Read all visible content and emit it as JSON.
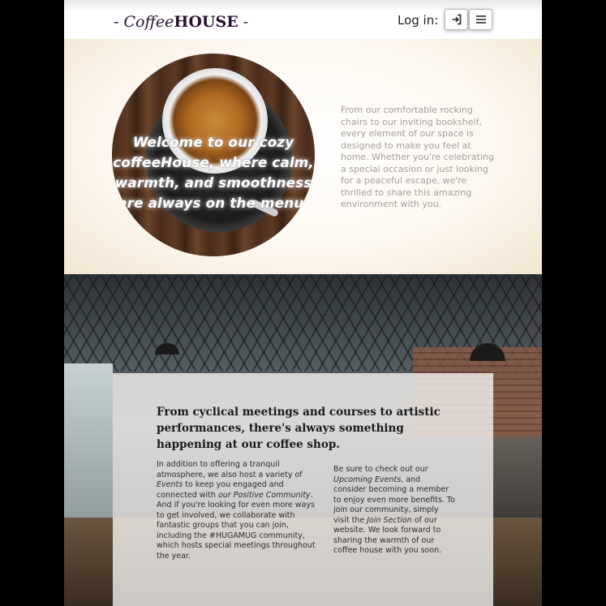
{
  "header": {
    "logo_prefix": "- ",
    "logo_coffee": "Coffee",
    "logo_house": "HOUSE",
    "logo_suffix": " -",
    "login_label": "Log in:",
    "login_icon": "login-arrow-icon",
    "menu_icon": "hamburger-menu-icon"
  },
  "hero": {
    "circle_text": "Welcome to our cozy coffeeHouse, where calm, warmth, and smoothness are always on the menu.",
    "description": "From our comfortable rocking chairs to our inviting bookshelf, every element of our space is designed to make you feel at home. Whether you're celebrating a special occasion or just looking for a peaceful escape, we're thrilled to share this amazing environment with you."
  },
  "cafe": {
    "headline": "From cyclical meetings and courses to artistic performances, there's always something happening at our coffee shop.",
    "left": {
      "part1": "In addition to offering a tranquil atmosphere, we also host a variety of ",
      "events_link": "Events",
      "part2": " to keep you engaged and connected with ",
      "community_link": "our Positive Community",
      "part3": ". And if you're looking for even more ways to get involved, we collaborate with fantastic groups that you can join, including the #HUGAMUG community, which hosts special meetings throughout the year."
    },
    "right": {
      "part1": "Be sure to check out our ",
      "upcoming_link": "Upcoming Events",
      "part2": ", and consider becoming a member to enjoy even more benefits. To join our community, simply visit the ",
      "join_link": "Join Section",
      "part3": " of our website. We look forward to sharing the warmth of our coffee house with you soon."
    }
  }
}
